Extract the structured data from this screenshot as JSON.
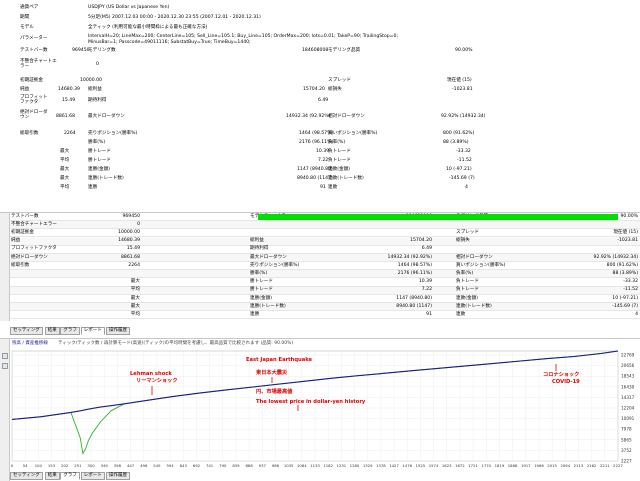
{
  "report": {
    "labels": {
      "expert": "通貨ペア",
      "period": "期間",
      "model": "モデル",
      "parameters": "パラメーター",
      "bars": "テストバー数",
      "mismatch": "不整合チャートエラー",
      "initial_deposit": "初期証拠金",
      "net_profit": "純益",
      "profit_factor": "プロフィットファクタ",
      "absolute_drawdown": "絶対ドローダウン",
      "total_trades": "総取引数"
    },
    "symbol": "USDJPY (US Dollar vs Japanese Yen)",
    "period": "5分足(M5) 2007.12.03 00:00 - 2020.12.30 23:55 (2007.12.01 - 2020.12.31)",
    "model": "全ティック (利用可能な最小時間枠による最も正確な方法)",
    "parameters_line1": "IntervalH=20; LineMax=200; CenterLine=105; Sell_Line=105.1; Buy_Line=105; OrderMax=200; lots=0.01; TakeP=90; TrailingStop=0;",
    "parameters_line2": "MinusBar=1; Passcode=49011116; SubstatBuy=True; TimeBuy=1440;",
    "bars_value": "969450",
    "ticks_label": "モデリング数",
    "ticks_value": "184608008",
    "quality_label": "モデリング品質",
    "quality_value": "90.00%",
    "mismatch_value": "0",
    "initial_deposit_value": "10000.00",
    "spread_label": "スプレッド",
    "spread_value": "現在値 (15)",
    "net_profit_value": "14680.39",
    "gross_profit_label": "総利益",
    "gross_profit_value": "15704.20",
    "gross_loss_label": "総損失",
    "gross_loss_value": "-1023.81",
    "profit_factor_value": "15.49",
    "expected_payoff_label": "期待利得",
    "expected_payoff_value": "6.49",
    "absolute_dd_value": "8861.68",
    "maximal_dd_label": "最大ドローダウン",
    "maximal_dd_value": "14932.34 (92.92%)",
    "relative_dd_label": "相対ドローダウン",
    "relative_dd_value": "92.92% (14932.34)",
    "total_trades_value": "2264",
    "short_label": "売りポジション(勝率%)",
    "short_value": "1464 (98.57%)",
    "long_label": "買いポジション(勝率%)",
    "long_value": "800 (91.62%)",
    "profit_trades_label": "勝率(%)",
    "profit_trades_value": "2176 (96.11%)",
    "loss_trades_label": "負率(%)",
    "loss_trades_value": "88 (3.89%)",
    "largest_label": "最大",
    "average_label": "平均",
    "maximum_label": "最大",
    "maximal_label": "最大",
    "avg_label": "平均",
    "largest_win_label": "勝トレード",
    "largest_win_value": "10.39",
    "largest_loss_label": "負トレード",
    "largest_loss_value": "-33.32",
    "avg_win_label": "勝トレード",
    "avg_win_value": "7.22",
    "avg_loss_label": "負トレード",
    "avg_loss_value": "-11.52",
    "cons_wins_label": "連勝(金額)",
    "cons_wins_value": "1147 (8940.80)",
    "cons_losses_label": "連敗(金額)",
    "cons_losses_value": "10 (-97.21)",
    "cons_profit_label": "連勝(トレード数)",
    "cons_profit_value": "8940.80 (1147)",
    "cons_loss_label": "連敗(トレード数)",
    "cons_loss_value": "-145.69 (7)",
    "avg_cons_wins_label": "連勝",
    "avg_cons_wins_value": "91",
    "avg_cons_losses_label": "連敗",
    "avg_cons_losses_value": "4"
  },
  "grid": {
    "rows": [
      {
        "c1": "テストバー数",
        "v1": "969450",
        "c2": "モデルティック数",
        "v2": "184608008",
        "c3": "モデリング品質",
        "v3": "90.00%"
      },
      {
        "c1": "不整合チャートエラー",
        "v1": "0",
        "c2": "",
        "v2": "",
        "c3": "",
        "v3": ""
      },
      {
        "c1": "初期証拠金",
        "v1": "10000.00",
        "c2": "",
        "v2": "",
        "c3": "スプレッド",
        "v3": "現在値 (15)"
      },
      {
        "c1": "純益",
        "v1": "14680.39",
        "c2": "総利益",
        "v2": "15704.20",
        "c3": "総損失",
        "v3": "-1023.81"
      },
      {
        "c1": "プロフィットファクタ",
        "v1": "15.49",
        "c2": "期待利得",
        "v2": "6.49",
        "c3": "",
        "v3": ""
      },
      {
        "c1": "絶対ドローダウン",
        "v1": "8861.68",
        "c2": "最大ドローダウン",
        "v2": "14932.34 (92.92%)",
        "c3": "相対ドローダウン",
        "v3": "92.92% (14932.34)"
      },
      {
        "c1": "総取引数",
        "v1": "2264",
        "c2": "売りポジション(勝率%)",
        "v2": "1464 (98.57%)",
        "c3": "買いポジション(勝率%)",
        "v3": "800 (91.62%)"
      },
      {
        "c1": "",
        "v1": "",
        "c2": "勝率(%)",
        "v2": "2176 (96.11%)",
        "c3": "負率(%)",
        "v3": "88 (3.89%)"
      },
      {
        "c1": "",
        "v1": "最大",
        "c2": "勝トレード",
        "v2": "10.39",
        "c3": "負トレード",
        "v3": "-33.32"
      },
      {
        "c1": "",
        "v1": "平均",
        "c2": "勝トレード",
        "v2": "7.22",
        "c3": "負トレード",
        "v3": "-11.52"
      },
      {
        "c1": "",
        "v1": "最大",
        "c2": "連勝(金額)",
        "v2": "1147 (8940.80)",
        "c3": "連敗(金額)",
        "v3": "10 (-97.21)"
      },
      {
        "c1": "",
        "v1": "最大",
        "c2": "連勝(トレード数)",
        "v2": "8940.80 (1147)",
        "c3": "連敗(トレード数)",
        "v3": "-145.69 (7)"
      },
      {
        "c1": "",
        "v1": "平均",
        "c2": "連勝",
        "v2": "91",
        "c3": "連敗",
        "v3": "4"
      }
    ]
  },
  "tabs": {
    "top": [
      "セッティング",
      "結果",
      "グラフ",
      "レポート",
      "操作履歴"
    ],
    "bottom": [
      "セッティング",
      "結果",
      "グラフ",
      "レポート",
      "操作履歴"
    ]
  },
  "graph": {
    "toolbar_text": "残高 / 資産推移線",
    "toolbar_note": "ティック/ティック数 / 再計算モード(高速)(ティック)の平均時間を考慮し、最高品質で比較されます (品質: 90.00%)",
    "y_ticks": [
      "22769",
      "20656",
      "18543",
      "16430",
      "14317",
      "12204",
      "10091",
      "7978",
      "5865",
      "3752",
      "2227"
    ],
    "x_ticks": [
      "0",
      "54",
      "104",
      "153",
      "202",
      "251",
      "300",
      "349",
      "398",
      "447",
      "496",
      "545",
      "594",
      "643",
      "692",
      "741",
      "790",
      "839",
      "888",
      "937",
      "986",
      "1035",
      "1084",
      "1133",
      "1182",
      "1231",
      "1280",
      "1329",
      "1378",
      "1427",
      "1476",
      "1525",
      "1574",
      "1623",
      "1672",
      "1721",
      "1770",
      "1819",
      "1868",
      "1917",
      "1966",
      "2015",
      "2064",
      "2113",
      "2162",
      "2211",
      "2227"
    ],
    "annotations": {
      "lehman_en": "Lehman shock",
      "lehman_jp": "リーマンショック",
      "japan_en": "East Japan Earthquake",
      "japan_jp": "東日本大震災",
      "yen_line1": "円、市場最高値",
      "yen_line2": "The lowest price in dollar-yen history",
      "corona_jp": "コロナショック",
      "corona_en": "COVID-19"
    },
    "colors": {
      "balance": "#1a1a8c",
      "equity": "#2db32d",
      "annotation": "#e00000"
    }
  },
  "chart_data": {
    "type": "line",
    "xlabel": "",
    "ylabel": "",
    "x": [
      0,
      110,
      220,
      255,
      265,
      275,
      285,
      300,
      330,
      370,
      420,
      500,
      600,
      700,
      800,
      900,
      1000,
      1100,
      1200,
      1300,
      1400,
      1500,
      1600,
      1700,
      1800,
      1900,
      2000,
      2100,
      2200,
      2264
    ],
    "ylim": [
      2227,
      22769
    ],
    "series": [
      {
        "values": [
          10000,
          10500,
          11300,
          11600,
          11700,
          11800,
          11900,
          12050,
          12300,
          12550,
          12900,
          13500,
          14250,
          14900,
          15500,
          16050,
          16600,
          17150,
          17700,
          18200,
          18650,
          19100,
          19550,
          20000,
          20450,
          20900,
          21350,
          21750,
          22300,
          22769
        ]
      },
      {
        "values": [
          10000,
          10500,
          11300,
          6500,
          3600,
          4500,
          6000,
          7400,
          9500,
          11600,
          12900,
          13500,
          14250,
          14900,
          15500,
          16050,
          16600,
          17150,
          17700,
          18200,
          18650,
          19100,
          19550,
          20000,
          20450,
          20900,
          21350,
          21750,
          22300,
          22769
        ]
      }
    ]
  }
}
